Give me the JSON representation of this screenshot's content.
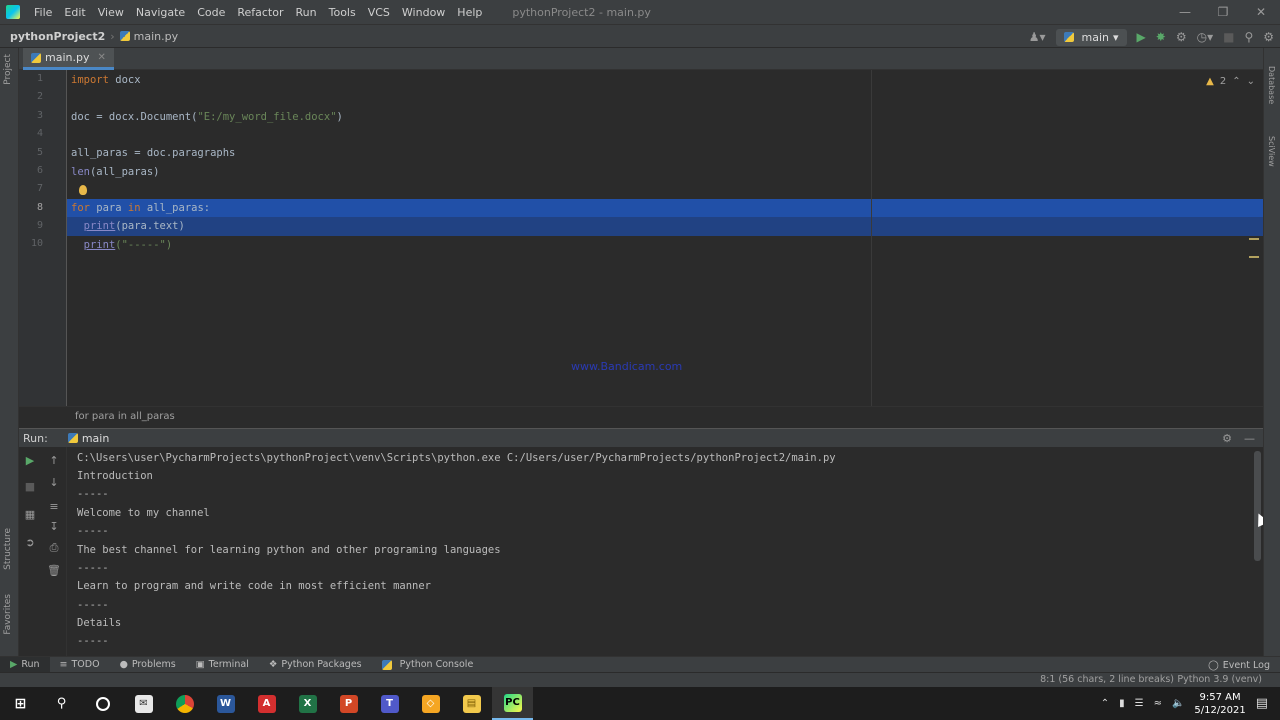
{
  "titlebar": {
    "menu": [
      "File",
      "Edit",
      "View",
      "Navigate",
      "Code",
      "Refactor",
      "Run",
      "Tools",
      "VCS",
      "Window",
      "Help"
    ],
    "window_title": "pythonProject2 - main.py"
  },
  "navbar": {
    "project": "pythonProject2",
    "file": "main.py",
    "run_config": "main"
  },
  "left_stripe": {
    "project": "Project",
    "structure": "Structure",
    "favorites": "Favorites"
  },
  "right_stripe": {
    "database": "Database",
    "sciview": "SciView"
  },
  "editor": {
    "tab": "main.py",
    "warnings": "2",
    "line_numbers": [
      "1",
      "2",
      "3",
      "4",
      "5",
      "6",
      "7",
      "8",
      "9",
      "10"
    ],
    "lines": {
      "l1_kw": "import",
      "l1_rest": " docx",
      "l3_pre": "doc = docx.Document(",
      "l3_str": "\"E:/my_word_file.docx\"",
      "l3_post": ")",
      "l5": "all_paras = doc.paragraphs",
      "l6_bi": "len",
      "l6_rest": "(all_paras)",
      "l8_kw": "for",
      "l8_mid": " para ",
      "l8_kw2": "in",
      "l8_rest": " all_paras:",
      "l9_bi": "print",
      "l9_rest": "(para.text)",
      "l10_bi": "print",
      "l10_str": "(\"-----\")"
    },
    "watermark": "www.Bandicam.com",
    "breadcrumb": "for para in all_paras"
  },
  "run_panel": {
    "label": "Run:",
    "tab": "main",
    "output": [
      "C:\\Users\\user\\PycharmProjects\\pythonProject\\venv\\Scripts\\python.exe C:/Users/user/PycharmProjects/pythonProject2/main.py",
      "Introduction",
      "-----",
      "Welcome to my channel",
      "-----",
      "The best channel for learning python and other programing languages",
      "-----",
      "Learn to program and write code in most efficient manner",
      "-----",
      "Details",
      "-----"
    ]
  },
  "tool_tabs": [
    "Run",
    "TODO",
    "Problems",
    "Terminal",
    "Python Packages",
    "Python Console"
  ],
  "event_log": "Event Log",
  "status": {
    "position": "8:1 (56 chars, 2 line breaks)",
    "interpreter": "Python 3.9 (venv)"
  },
  "taskbar": {
    "time": "9:57 AM",
    "date": "5/12/2021"
  },
  "colors": {
    "selection": "#214283",
    "keyword": "#cc7832",
    "string": "#6a8759",
    "builtin": "#8888c6"
  }
}
